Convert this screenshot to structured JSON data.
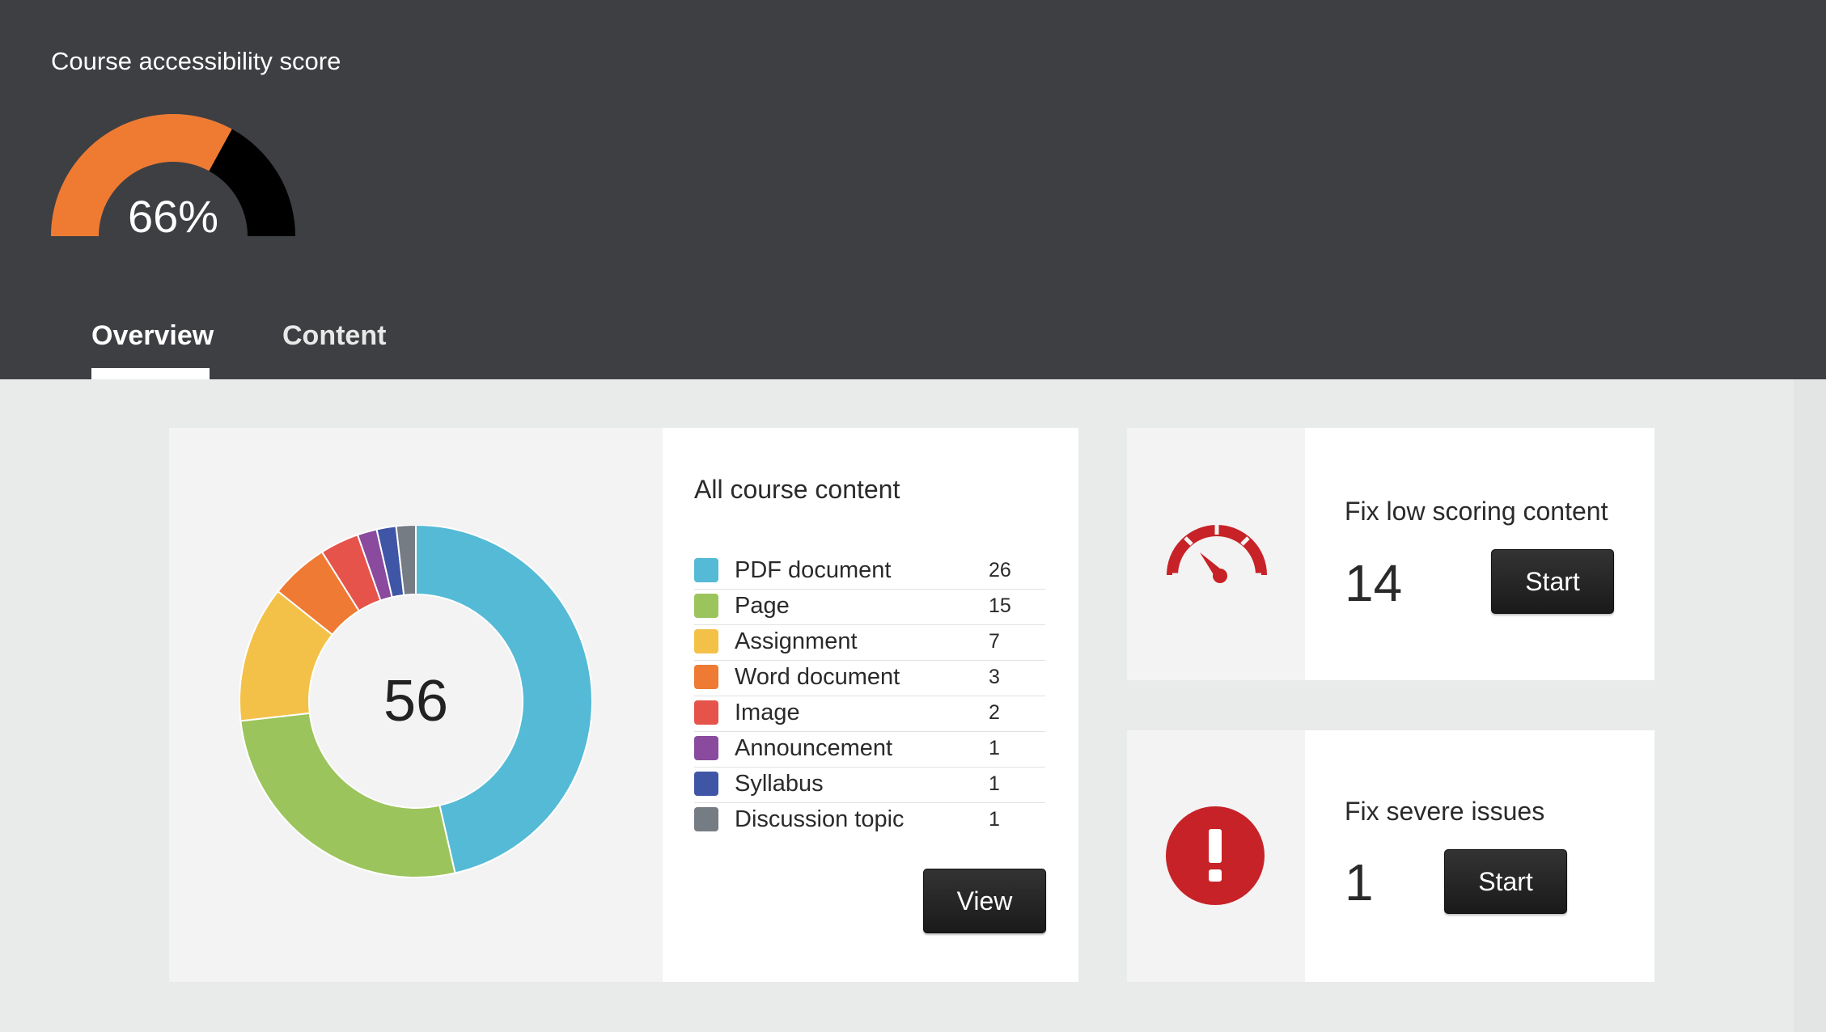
{
  "header": {
    "title": "Course accessibility score",
    "score_label": "66%",
    "score_percent": 66,
    "colors": {
      "filled": "#ef7b33",
      "remaining": "#000000"
    }
  },
  "tabs": [
    {
      "label": "Overview",
      "active": true
    },
    {
      "label": "Content",
      "active": false
    }
  ],
  "content_card": {
    "title": "All course content",
    "total": "56",
    "view_label": "View",
    "items": [
      {
        "label": "PDF document",
        "count": "26",
        "value": 26,
        "color": "#55bad6"
      },
      {
        "label": "Page",
        "count": "15",
        "value": 15,
        "color": "#9cc45c"
      },
      {
        "label": "Assignment",
        "count": "7",
        "value": 7,
        "color": "#f4c148"
      },
      {
        "label": "Word document",
        "count": "3",
        "value": 3,
        "color": "#ee7a33"
      },
      {
        "label": "Image",
        "count": "2",
        "value": 2,
        "color": "#e5534a"
      },
      {
        "label": "Announcement",
        "count": "1",
        "value": 1,
        "color": "#8a4a9e"
      },
      {
        "label": "Syllabus",
        "count": "1",
        "value": 1,
        "color": "#3f56a6"
      },
      {
        "label": "Discussion topic",
        "count": "1",
        "value": 1,
        "color": "#767c84"
      }
    ]
  },
  "fix_low": {
    "title": "Fix low scoring content",
    "count": "14",
    "button": "Start",
    "icon": "speedometer-icon",
    "color": "#c72227"
  },
  "fix_severe": {
    "title": "Fix severe issues",
    "count": "1",
    "button": "Start",
    "icon": "exclamation-icon",
    "color": "#c72227"
  }
}
